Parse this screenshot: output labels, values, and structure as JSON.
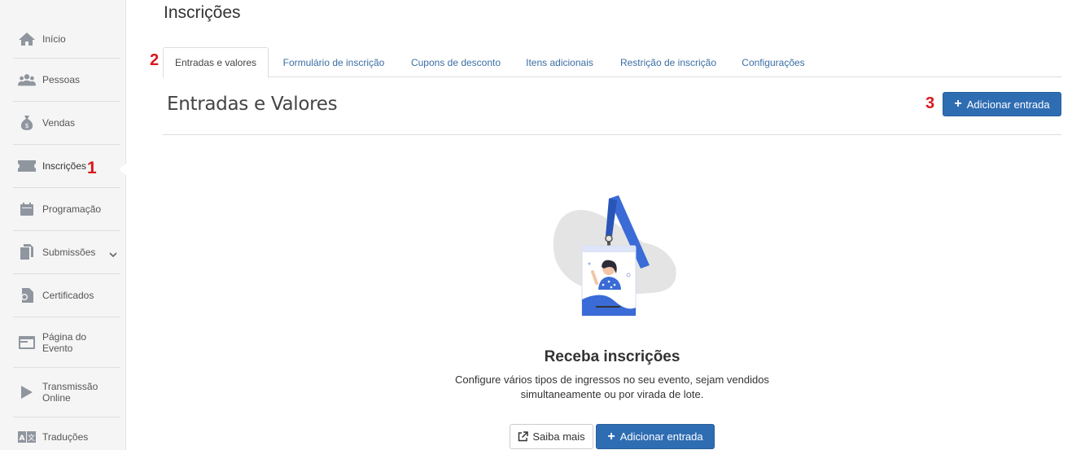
{
  "sidebar": {
    "items": [
      {
        "label": "Início",
        "icon": "home-icon"
      },
      {
        "label": "Pessoas",
        "icon": "people-icon"
      },
      {
        "label": "Vendas",
        "icon": "money-bag-icon"
      },
      {
        "label": "Inscrições",
        "icon": "ticket-icon",
        "active": true
      },
      {
        "label": "Programação",
        "icon": "calendar-icon"
      },
      {
        "label": "Submissões",
        "icon": "documents-icon"
      },
      {
        "label": "Certificados",
        "icon": "certificate-icon"
      },
      {
        "label": "Página do\nEvento",
        "icon": "webpage-icon"
      },
      {
        "label": "Transmissão\nOnline",
        "icon": "play-icon"
      },
      {
        "label": "Traduções",
        "icon": "translate-icon"
      }
    ],
    "marker": "1"
  },
  "page": {
    "title": "Inscrições"
  },
  "tabs": {
    "marker": "2",
    "items": [
      {
        "label": "Entradas e valores"
      },
      {
        "label": "Formulário de inscrição"
      },
      {
        "label": "Cupons de desconto"
      },
      {
        "label": "Itens adicionais"
      },
      {
        "label": "Restrição de inscrição"
      },
      {
        "label": "Configurações"
      }
    ]
  },
  "section": {
    "title": "Entradas e Valores",
    "add_button": "Adicionar entrada",
    "marker": "3"
  },
  "empty_state": {
    "title": "Receba inscrições",
    "description": "Configure vários tipos de ingressos no seu evento, sejam vendidos simultaneamente ou por virada de lote.",
    "learn_more": "Saiba mais",
    "add_button": "Adicionar entrada"
  },
  "colors": {
    "primary": "#2f6db3",
    "marker_red": "#d9161c",
    "link_blue": "#3b6ea5"
  }
}
